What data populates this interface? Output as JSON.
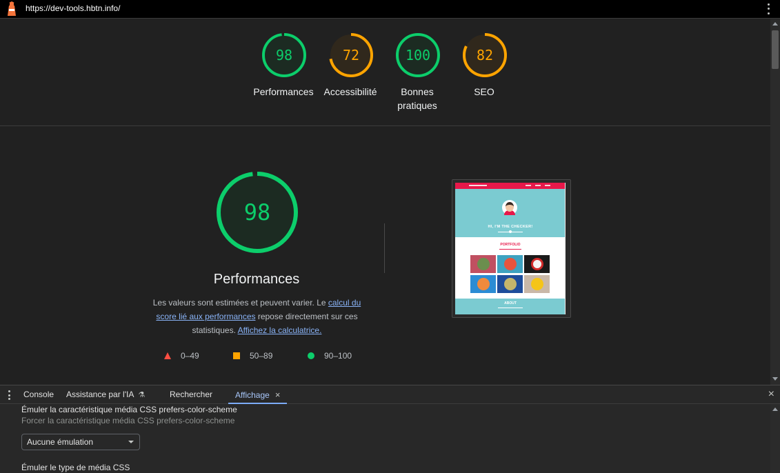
{
  "browser": {
    "url": "https://dev-tools.hbtn.info/",
    "logo_icon": "lighthouse-icon",
    "menu_icon": "kebab-menu-icon"
  },
  "summary_scores": [
    {
      "label": "Performances",
      "score": "98",
      "status": "pass",
      "color": "#0cce6b"
    },
    {
      "label": "Accessibilité",
      "score": "72",
      "status": "average",
      "color": "#ffa400"
    },
    {
      "label": "Bonnes pratiques",
      "score": "100",
      "status": "pass",
      "color": "#0cce6b"
    },
    {
      "label": "SEO",
      "score": "82",
      "status": "average",
      "color": "#ffa400"
    }
  ],
  "performance": {
    "score": "98",
    "title": "Performances",
    "desc_prefix": "Les valeurs sont estimées et peuvent varier. Le ",
    "desc_link1": "calcul du score lié aux performances",
    "desc_middle": " repose directement sur ces statistiques. ",
    "desc_link2": "Affichez la calculatrice.",
    "legend": [
      {
        "range": "0–49",
        "shape": "triangle",
        "color": "#ff4e42"
      },
      {
        "range": "50–89",
        "shape": "square",
        "color": "#ffa400"
      },
      {
        "range": "90–100",
        "shape": "circle",
        "color": "#0cce6b"
      }
    ]
  },
  "thumbnail": {
    "hero_text": "HI, I'M THE CHECKER!",
    "portfolio_title": "PORTFOLIO",
    "about_title": "ABOUT"
  },
  "drawer": {
    "tabs": [
      {
        "label": "Console"
      },
      {
        "label": "Assistance par l'IA"
      },
      {
        "label": "Rechercher"
      },
      {
        "label": "Affichage"
      }
    ],
    "active_tab": "Affichage",
    "close_symbol": "×",
    "flask_icon": "⚗",
    "options": {
      "color_scheme_title": "Émuler la caractéristique média CSS prefers-color-scheme",
      "color_scheme_sub": "Forcer la caractéristique média CSS prefers-color-scheme",
      "color_scheme_value": "Aucune émulation",
      "media_type_title": "Émuler le type de média CSS"
    }
  }
}
